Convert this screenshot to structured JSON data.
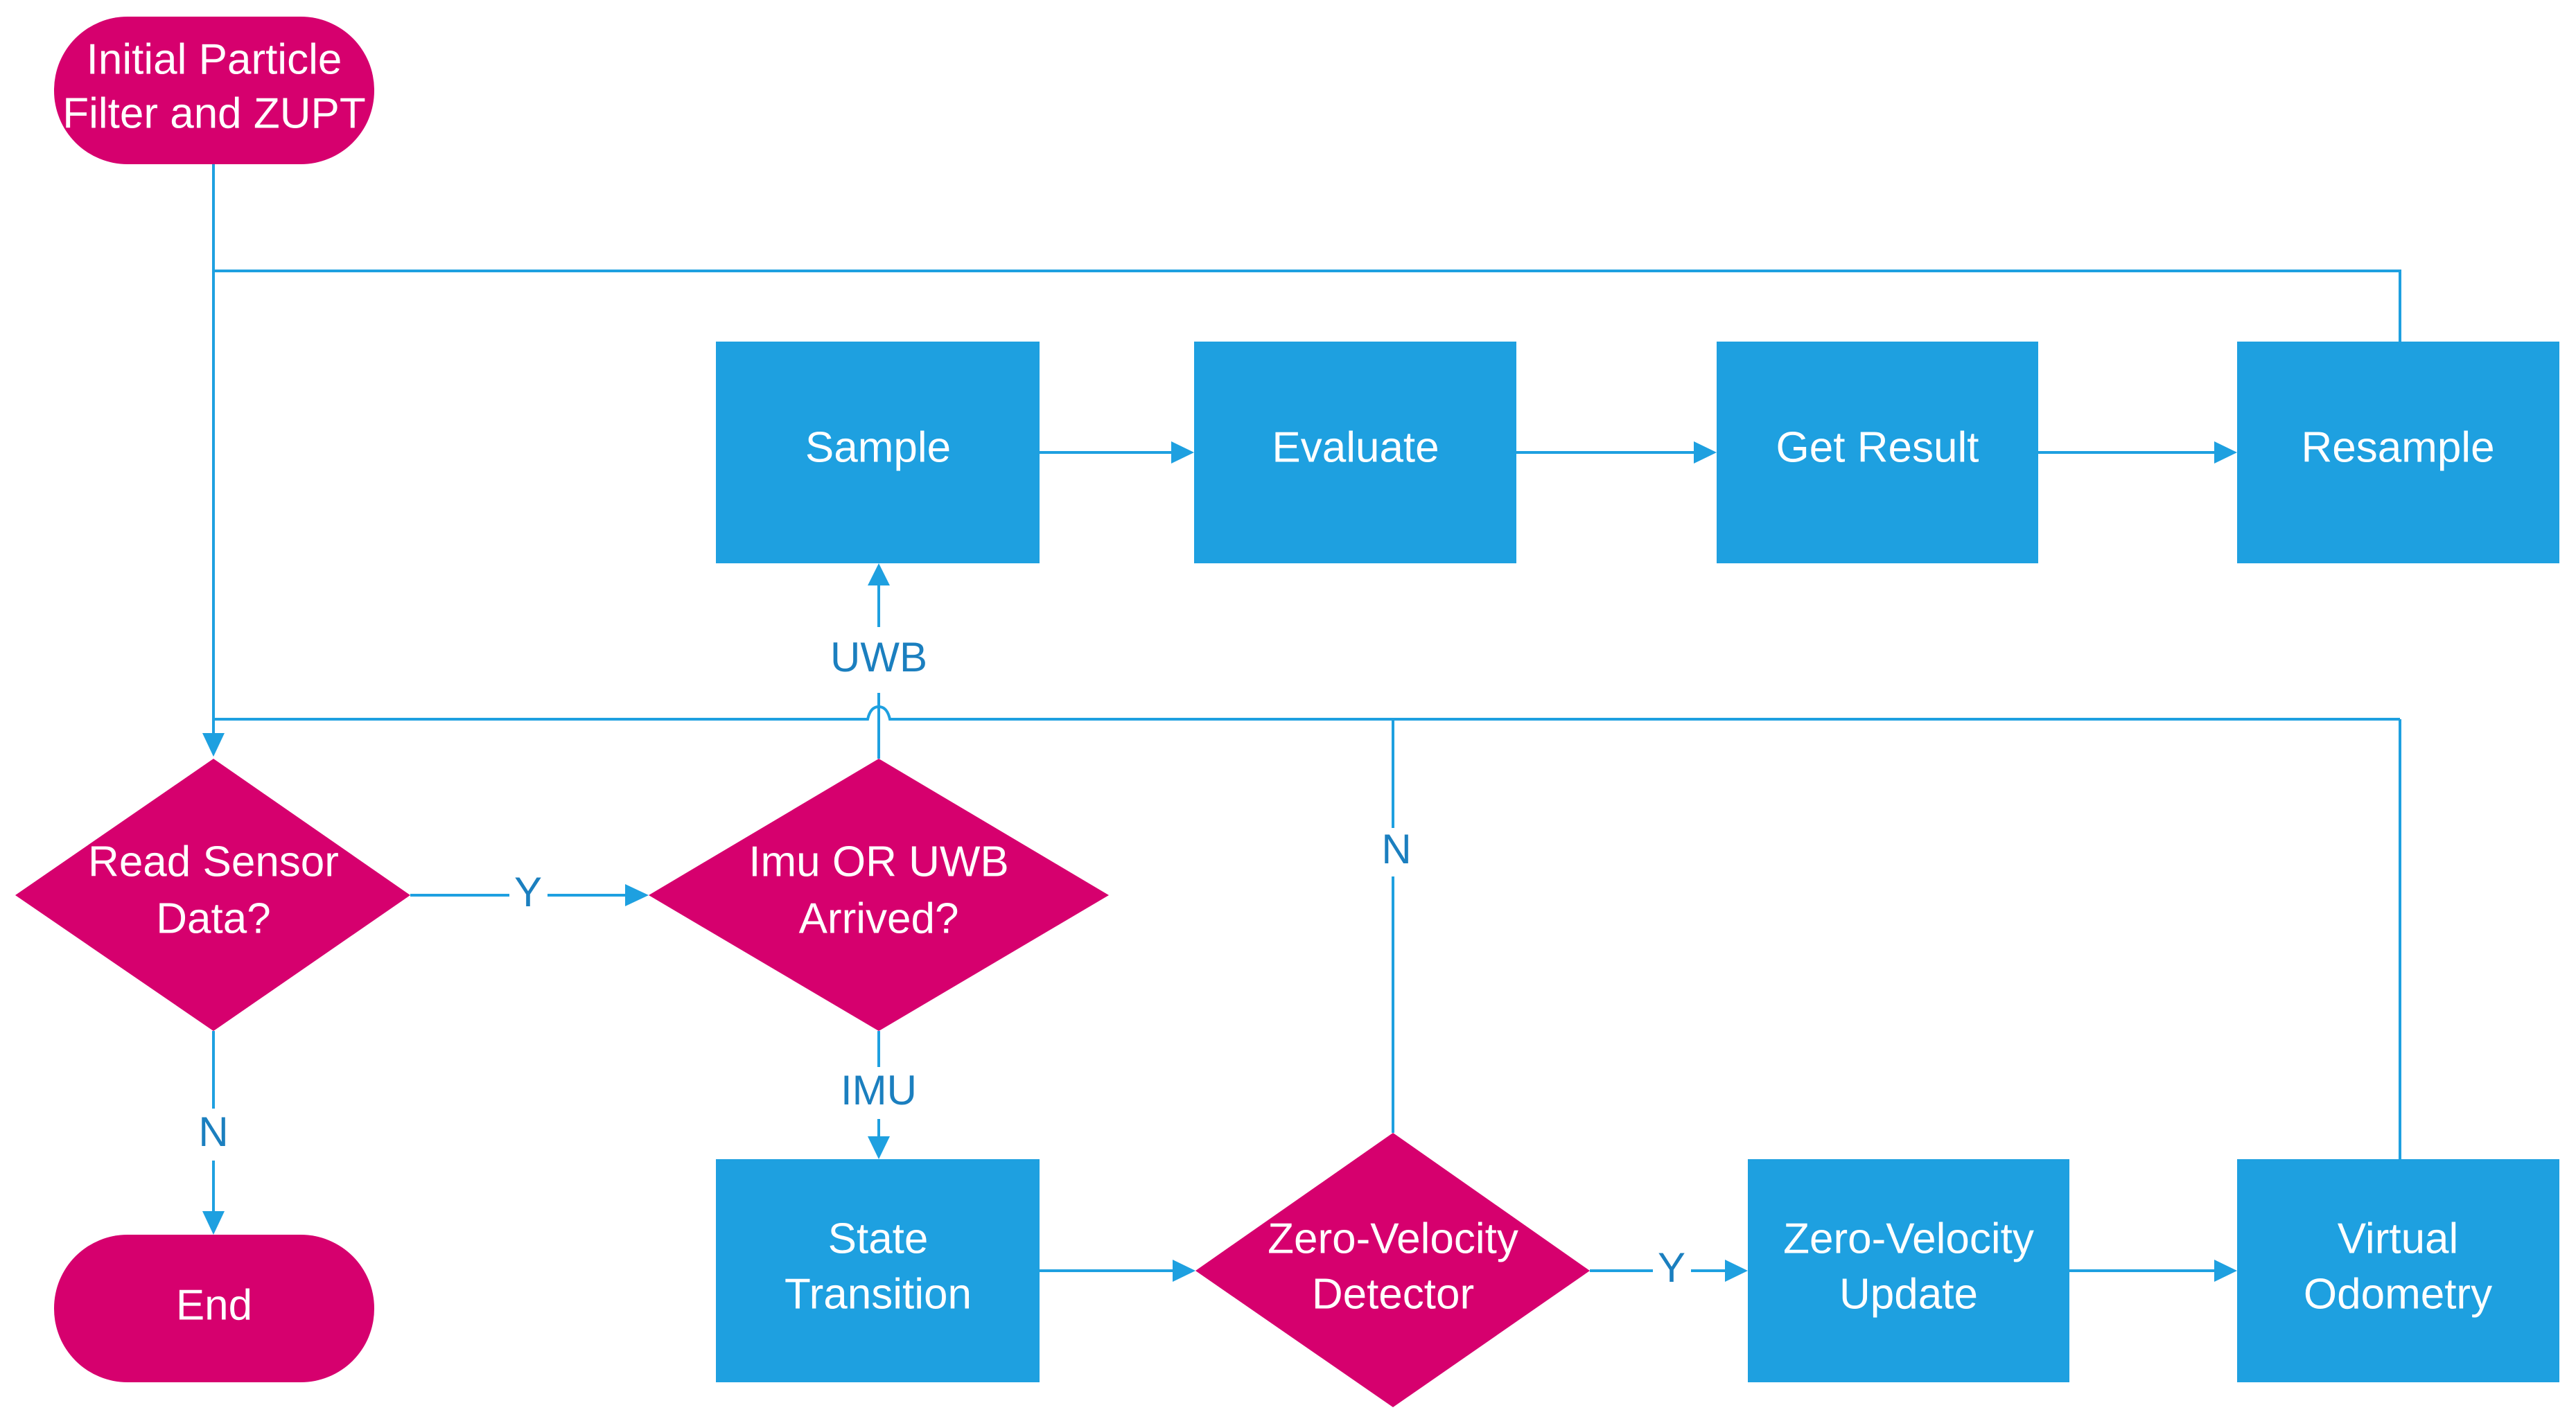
{
  "diagram": {
    "colors": {
      "terminal": "#d6006e",
      "decision": "#d6006e",
      "process": "#1ea0e0",
      "connector": "#1ea0e0",
      "label": "#1b7fbf",
      "node_text": "#ffffff"
    },
    "nodes": {
      "start": {
        "type": "terminal",
        "lines": [
          "Initial Particle",
          "Filter and ZUPT"
        ]
      },
      "sample": {
        "type": "process",
        "lines": [
          "Sample"
        ]
      },
      "evaluate": {
        "type": "process",
        "lines": [
          "Evaluate"
        ]
      },
      "get_result": {
        "type": "process",
        "lines": [
          "Get Result"
        ]
      },
      "resample": {
        "type": "process",
        "lines": [
          "Resample"
        ]
      },
      "read_sensor": {
        "type": "decision",
        "lines": [
          "Read Sensor",
          "Data?"
        ]
      },
      "imu_or_uwb": {
        "type": "decision",
        "lines": [
          "Imu OR UWB",
          "Arrived?"
        ]
      },
      "state_transition": {
        "type": "process",
        "lines": [
          "State",
          "Transition"
        ]
      },
      "zv_detector": {
        "type": "decision",
        "lines": [
          "Zero-Velocity",
          "Detector"
        ]
      },
      "zv_update": {
        "type": "process",
        "lines": [
          "Zero-Velocity",
          "Update"
        ]
      },
      "virtual_odometry": {
        "type": "process",
        "lines": [
          "Virtual",
          "Odometry"
        ]
      },
      "end": {
        "type": "terminal",
        "lines": [
          "End"
        ]
      }
    },
    "edge_labels": {
      "read_yes": "Y",
      "read_no": "N",
      "uwb": "UWB",
      "imu": "IMU",
      "zv_no": "N",
      "zv_yes": "Y"
    },
    "edges": [
      {
        "from": "start",
        "to": "read_sensor"
      },
      {
        "from": "read_sensor",
        "to": "imu_or_uwb",
        "label": "Y"
      },
      {
        "from": "read_sensor",
        "to": "end",
        "label": "N"
      },
      {
        "from": "imu_or_uwb",
        "to": "sample",
        "label": "UWB"
      },
      {
        "from": "imu_or_uwb",
        "to": "state_transition",
        "label": "IMU"
      },
      {
        "from": "sample",
        "to": "evaluate"
      },
      {
        "from": "evaluate",
        "to": "get_result"
      },
      {
        "from": "get_result",
        "to": "resample"
      },
      {
        "from": "resample",
        "to": "read_sensor"
      },
      {
        "from": "state_transition",
        "to": "zv_detector"
      },
      {
        "from": "zv_detector",
        "to": "zv_update",
        "label": "Y"
      },
      {
        "from": "zv_detector",
        "to": "read_sensor",
        "label": "N"
      },
      {
        "from": "zv_update",
        "to": "virtual_odometry"
      },
      {
        "from": "virtual_odometry",
        "to": "read_sensor"
      }
    ]
  }
}
